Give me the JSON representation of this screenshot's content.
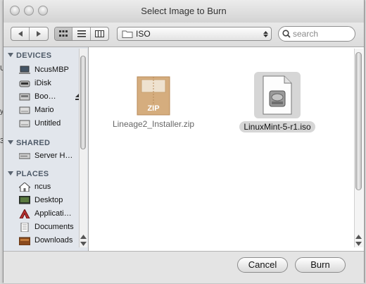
{
  "window": {
    "title": "Select Image to Burn"
  },
  "toolbar": {
    "location": "ISO",
    "search_placeholder": "search"
  },
  "sidebar": {
    "sections": [
      {
        "label": "DEVICES",
        "items": [
          "NcusMBP",
          "iDisk",
          "Boo…",
          "Mario",
          "Untitled"
        ]
      },
      {
        "label": "SHARED",
        "items": [
          "Server H…"
        ]
      },
      {
        "label": "PLACES",
        "items": [
          "ncus",
          "Desktop",
          "Applicati…",
          "Documents",
          "Downloads"
        ]
      }
    ]
  },
  "files": [
    {
      "name": "Lineage2_Installer.zip",
      "icon": "zip-archive-icon",
      "badge": "ZIP",
      "selected": false
    },
    {
      "name": "LinuxMint-5-r1.iso",
      "icon": "disk-image-icon",
      "selected": true
    }
  ],
  "buttons": {
    "cancel": "Cancel",
    "burn": "Burn"
  },
  "colors": {
    "sidebar_bg": "#e2e6ec",
    "selection": "#d6d6d6"
  }
}
